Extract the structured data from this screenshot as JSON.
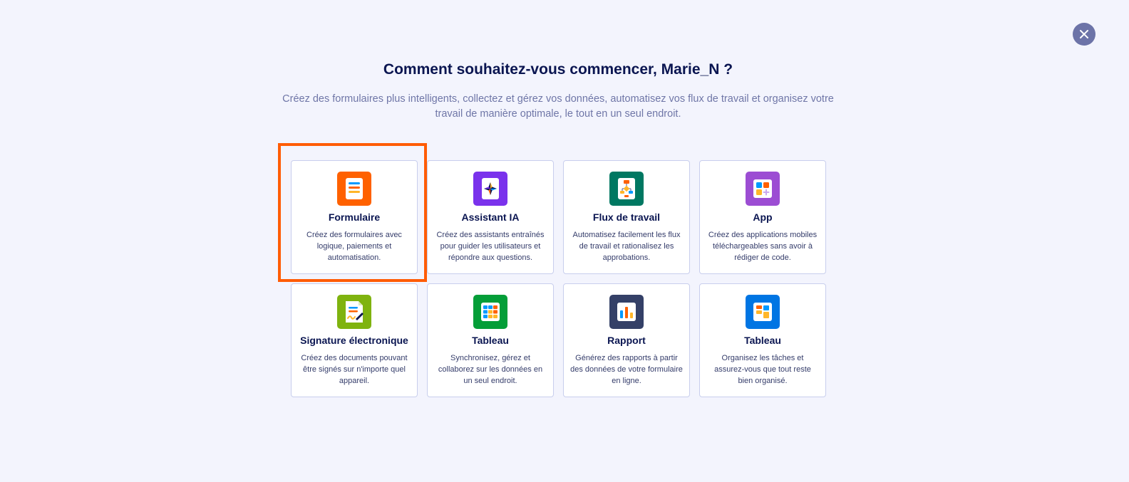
{
  "header": {
    "title": "Comment souhaitez-vous commencer, Marie_N ?",
    "subtitle": "Créez des formulaires plus intelligents, collectez et gérez vos données, automatisez vos flux de travail et organisez votre travail de manière optimale, le tout en un seul endroit."
  },
  "close": {
    "icon": "close-icon"
  },
  "cards": [
    {
      "title": "Formulaire",
      "desc": "Créez des formulaires avec logique, paiements et automatisation.",
      "icon": "form-icon",
      "color": "#ff6100"
    },
    {
      "title": "Assistant IA",
      "desc": "Créez des assistants entraînés pour guider les utilisateurs et répondre aux questions.",
      "icon": "ai-sparkle-icon",
      "color": "#7a32ec"
    },
    {
      "title": "Flux de travail",
      "desc": "Automatisez facilement les flux de travail et rationalisez les approbations.",
      "icon": "workflow-icon",
      "color": "#007862"
    },
    {
      "title": "App",
      "desc": "Créez des applications mobiles téléchargeables sans avoir à rédiger de code.",
      "icon": "app-icon",
      "color": "#9c4dd3"
    },
    {
      "title": "Signature électronique",
      "desc": "Créez des documents pouvant être signés sur n'importe quel appareil.",
      "icon": "signature-icon",
      "color": "#7fb30f"
    },
    {
      "title": "Tableau",
      "desc": "Synchronisez, gérez et collaborez sur les données en un seul endroit.",
      "icon": "table-icon",
      "color": "#049e38"
    },
    {
      "title": "Rapport",
      "desc": "Générez des rapports à partir des données de votre formulaire en ligne.",
      "icon": "report-icon",
      "color": "#344067"
    },
    {
      "title": "Tableau",
      "desc": "Organisez les tâches et assurez-vous que tout reste bien organisé.",
      "icon": "board-icon",
      "color": "#0075e3"
    }
  ]
}
